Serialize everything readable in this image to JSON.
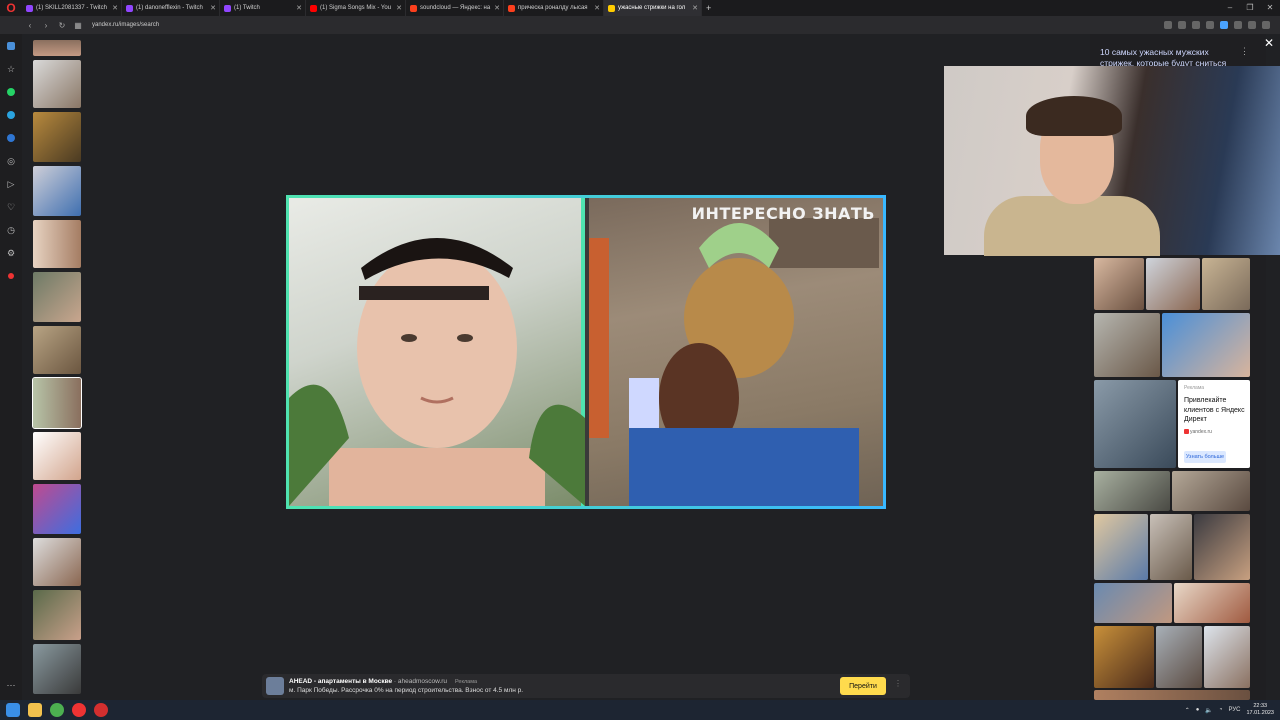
{
  "tabs": [
    {
      "label": "(1) SKILL2081337 - Twitch",
      "color": "#9146ff"
    },
    {
      "label": "(1) danonefflexin - Twitch",
      "color": "#9146ff"
    },
    {
      "label": "(1) Twitch",
      "color": "#9146ff"
    },
    {
      "label": "(1) Sigma Songs Mix - You",
      "color": "#ff0000"
    },
    {
      "label": "soundcloud — Яндекс: на",
      "color": "#fc3f1d"
    },
    {
      "label": "прическа роналду лысая",
      "color": "#fc3f1d"
    },
    {
      "label": "ужасные стрижки на гол",
      "color": "#ffcc00"
    }
  ],
  "new_tab_label": "+",
  "window_controls": [
    "–",
    "❐",
    "✕"
  ],
  "address": {
    "url": "yandex.ru/images/search",
    "back": "‹",
    "forward": "›",
    "reload": "↻"
  },
  "sidebar_icons": [
    "home-icon",
    "whatsapp-icon",
    "telegram-icon",
    "vk-icon",
    "music-icon",
    "play-icon",
    "heart-icon",
    "history-icon",
    "settings-icon",
    "pin-icon"
  ],
  "viewer": {
    "overlay_text": "ИНТЕРЕСНО ЗНАТЬ"
  },
  "ad_banner": {
    "title": "AHEAD - апартаменты в Москве",
    "domain": " · aheadmoscow.ru",
    "tag": "Реклама",
    "text": "м. Парк Победы. Рассрочка 0% на период строительства. Взнос от 4.5 млн р.",
    "button": "Перейти",
    "more": "⋮"
  },
  "right_panel": {
    "related_title": "10 самых ужасных мужских стрижек, которые будут сниться",
    "close": "✕",
    "more": "⋮"
  },
  "ad_card": {
    "label": "Реклама",
    "text": "Привлекайте клиентов с Яндекс Директ",
    "domain": "yandex.ru",
    "button": "Узнать больше"
  },
  "taskbar": {
    "lang": "РУС",
    "time": "22:33",
    "date": "17.01.2023"
  },
  "colors": {
    "frame_start": "#4fe3b0",
    "frame_end": "#39b8ff",
    "ad_button": "#ffdb4d"
  }
}
